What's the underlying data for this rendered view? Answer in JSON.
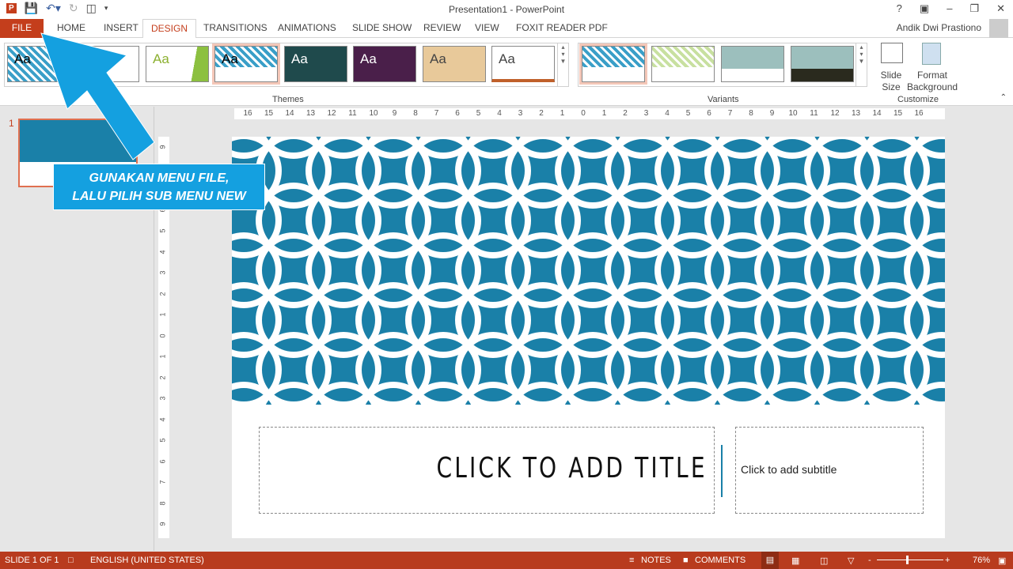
{
  "app": {
    "title": "Presentation1 - PowerPoint",
    "user": "Andik Dwi Prastiono"
  },
  "tabs": [
    "FILE",
    "HOME",
    "INSERT",
    "DESIGN",
    "TRANSITIONS",
    "ANIMATIONS",
    "SLIDE SHOW",
    "REVIEW",
    "VIEW",
    "FOXIT READER PDF"
  ],
  "active_tab": "DESIGN",
  "ribbon": {
    "themes_label": "Themes",
    "variants_label": "Variants",
    "customize_label": "Customize",
    "slide_size": "Slide Size",
    "format_background": "Format Background",
    "theme_sample": "Aa"
  },
  "slide_panel": {
    "number": "1"
  },
  "slide": {
    "title": "CLICK TO ADD TITLE",
    "subtitle": "Click to add subtitle",
    "pattern_color": "#1a80a8"
  },
  "callout": {
    "line1": "GUNAKAN MENU FILE,",
    "line2": "LALU PILIH SUB MENU NEW",
    "color": "#14a0e0"
  },
  "status": {
    "slide": "SLIDE 1 OF 1",
    "language": "ENGLISH (UNITED STATES)",
    "notes": "NOTES",
    "comments": "COMMENTS",
    "zoom": "76%"
  },
  "hruler": [
    "16",
    "15",
    "14",
    "13",
    "12",
    "11",
    "10",
    "9",
    "8",
    "7",
    "6",
    "5",
    "4",
    "3",
    "2",
    "1",
    "0",
    "1",
    "2",
    "3",
    "4",
    "5",
    "6",
    "7",
    "8",
    "9",
    "10",
    "11",
    "12",
    "13",
    "14",
    "15",
    "16"
  ],
  "vruler": [
    "9",
    "8",
    "7",
    "6",
    "5",
    "4",
    "3",
    "2",
    "1",
    "0",
    "1",
    "2",
    "3",
    "4",
    "5",
    "6",
    "7",
    "8",
    "9"
  ],
  "colors": {
    "accent": "#c43e1c",
    "status_bar": "#b83b1e"
  }
}
